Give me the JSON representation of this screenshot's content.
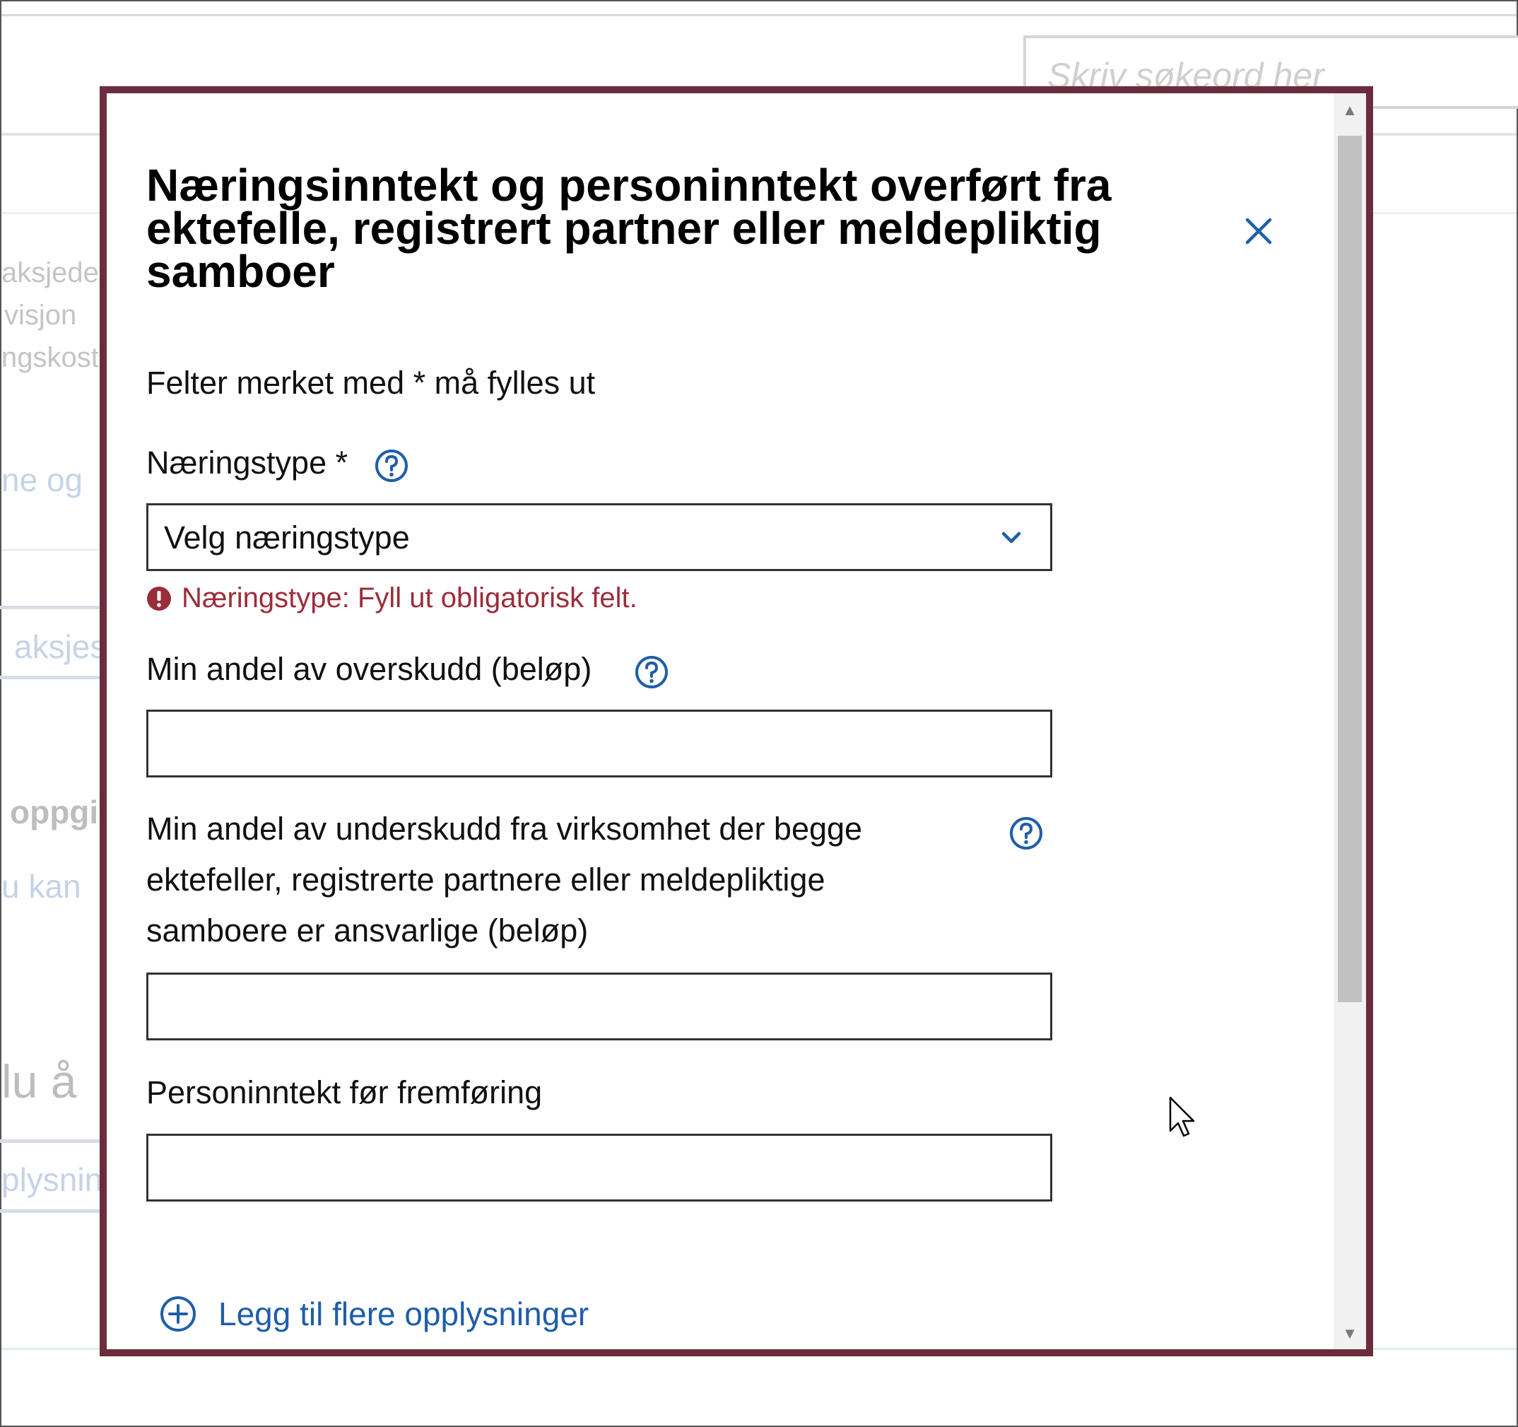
{
  "background": {
    "search_placeholder": "Skriv søkeord her",
    "fragments": [
      "aksjede",
      "visjon",
      "ngskost",
      "ne og",
      "aksjes",
      "oppgi",
      "u kan",
      "lu å",
      "plysnin"
    ]
  },
  "modal": {
    "title": "Næringsinntekt og personinntekt overført fra ektefelle, registrert partner eller meldepliktig samboer",
    "close_icon": "close-icon",
    "required_note": "Felter merket med * må fylles ut",
    "fields": {
      "naeringstype": {
        "label": "Næringstype *",
        "selected_value": "Velg næringstype",
        "error": "Næringstype: Fyll ut obligatorisk felt."
      },
      "overskudd": {
        "label": "Min andel av overskudd (beløp)",
        "value": ""
      },
      "underskudd": {
        "label": "Min andel av underskudd fra virksomhet der begge ektefeller, registrerte partnere eller meldepliktige samboere er ansvarlige (beløp)",
        "value": ""
      },
      "personinntekt": {
        "label": "Personinntekt før fremføring",
        "value": ""
      }
    },
    "add_more_label": "Legg til flere opplysninger"
  },
  "colors": {
    "modal_border": "#6b2d3d",
    "link_blue": "#1f5ea8",
    "error_red": "#9b2d3a"
  }
}
